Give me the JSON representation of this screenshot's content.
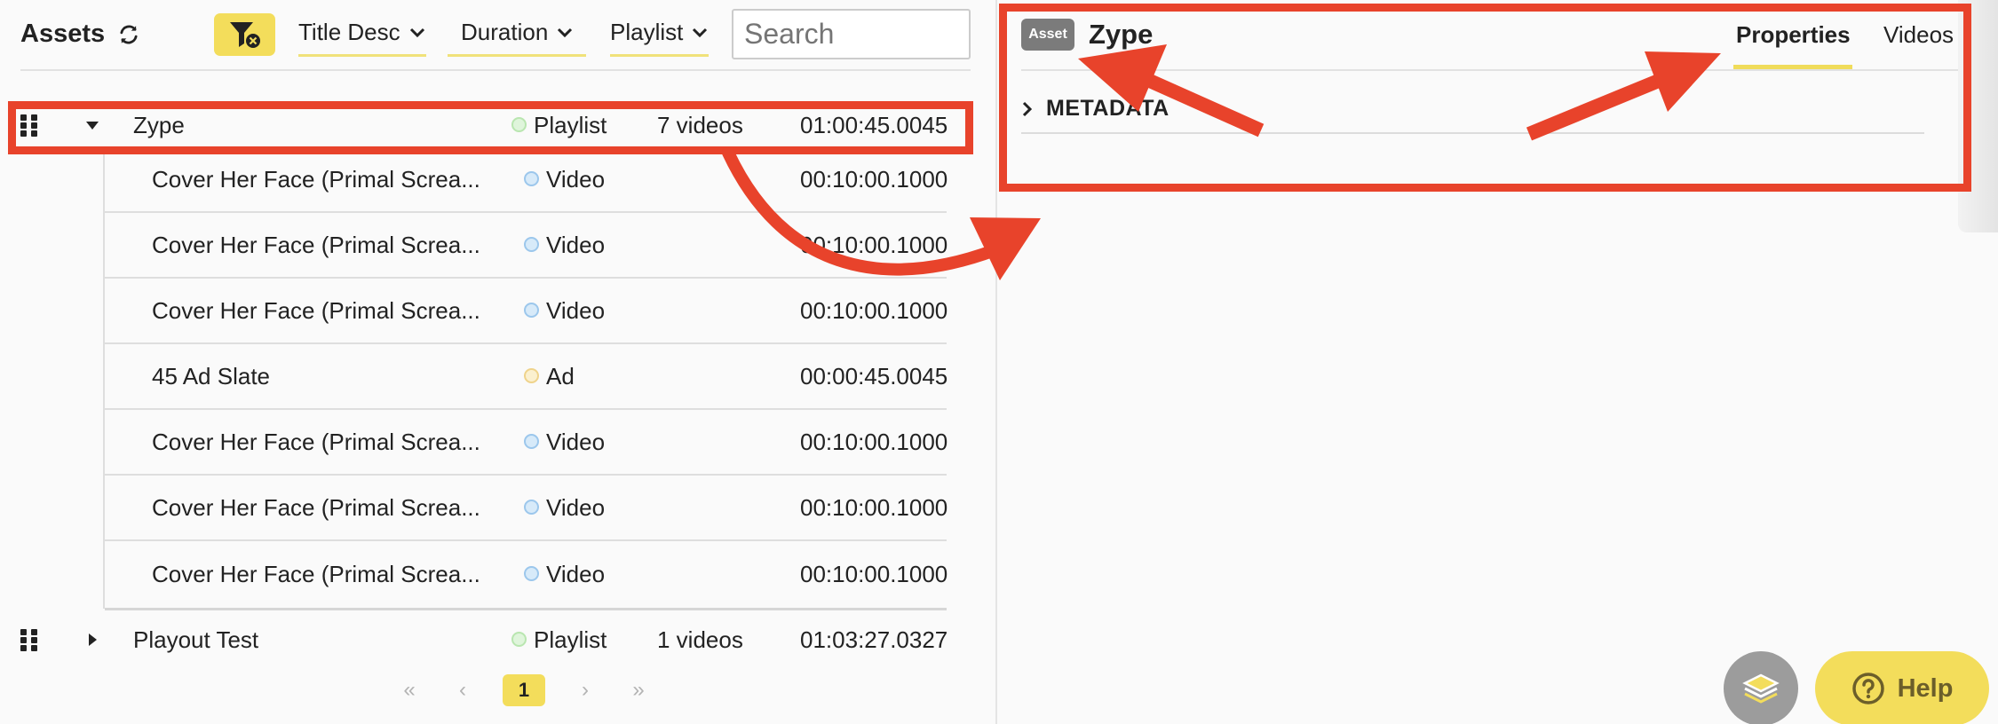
{
  "assets_panel": {
    "title": "Assets",
    "sort_title": "Title Desc",
    "sort_duration": "Duration",
    "sort_type": "Playlist",
    "search_placeholder": "Search"
  },
  "rows": [
    {
      "title": "Zype",
      "type": "Playlist",
      "count": "7 videos",
      "duration": "01:00:45.0045"
    },
    {
      "title": "Playout Test",
      "type": "Playlist",
      "count": "1 videos",
      "duration": "01:03:27.0327"
    }
  ],
  "children": [
    {
      "title": "Cover Her Face (Primal Screa...",
      "type": "Video",
      "duration": "00:10:00.1000"
    },
    {
      "title": "Cover Her Face (Primal Screa...",
      "type": "Video",
      "duration": "00:10:00.1000"
    },
    {
      "title": "Cover Her Face (Primal Screa...",
      "type": "Video",
      "duration": "00:10:00.1000"
    },
    {
      "title": "45 Ad Slate",
      "type": "Ad",
      "duration": "00:00:45.0045"
    },
    {
      "title": "Cover Her Face (Primal Screa...",
      "type": "Video",
      "duration": "00:10:00.1000"
    },
    {
      "title": "Cover Her Face (Primal Screa...",
      "type": "Video",
      "duration": "00:10:00.1000"
    },
    {
      "title": "Cover Her Face (Primal Screa...",
      "type": "Video",
      "duration": "00:10:00.1000"
    }
  ],
  "pagination": {
    "first": "«",
    "prev": "‹",
    "current": "1",
    "next": "›",
    "last": "»"
  },
  "detail": {
    "badge": "Asset",
    "title": "Zype",
    "tab_properties": "Properties",
    "tab_videos": "Videos",
    "section": "METADATA"
  },
  "help": {
    "label": "Help"
  },
  "colors": {
    "accent": "#f3dd5b",
    "annotation": "#e8432b",
    "playlist_dot": "#b9e6b0",
    "video_dot": "#9cc7ec",
    "ad_dot": "#efd38b"
  }
}
